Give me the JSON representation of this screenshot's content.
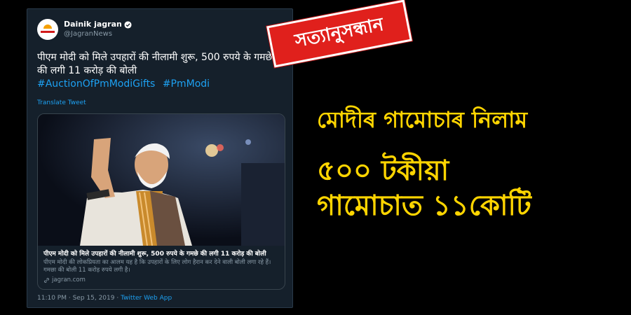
{
  "tweet": {
    "display_name": "Dainik jagran",
    "handle": "@JagranNews",
    "logo_text": "दैनिक जागरण",
    "text": "पीएम मोदी को मिले उपहारों की नीलामी शुरू, 500 रुपये के गमछे की लगी 11 करोड़ की बोली",
    "hashtags": [
      "#AuctionOfPmModiGifts",
      "#PmModi"
    ],
    "translate": "Translate Tweet",
    "card": {
      "title": "पीएम मोदी को मिले उपहारों की नीलामी शुरू, 500 रुपये के गमछे की लगी 11 करोड़ की बोली",
      "description": "पीएम मोदी की लोकप्रियता का आलम यह है कि उपहारों के लिए लोग हैरान कर देने वाली बोली लगा रहे हैं। गमछा की बोली 11 करोड़ रुपये लगी है।",
      "domain": "jagran.com"
    },
    "timestamp": "11:10 PM · Sep 15, 2019 · ",
    "via": "Twitter Web App"
  },
  "stamp": {
    "text": "সত্যানুসন্ধান"
  },
  "headline": {
    "line1": "মোদীৰ গামোচাৰ নিলাম",
    "line2": "৫০০ টকীয়া",
    "line3": "গামোচাত ১১কোটি"
  },
  "colors": {
    "tweet_bg": "#15202b",
    "link_blue": "#1da1f2",
    "stamp_red": "#e0201c",
    "headline_yellow": "#ffd500"
  }
}
